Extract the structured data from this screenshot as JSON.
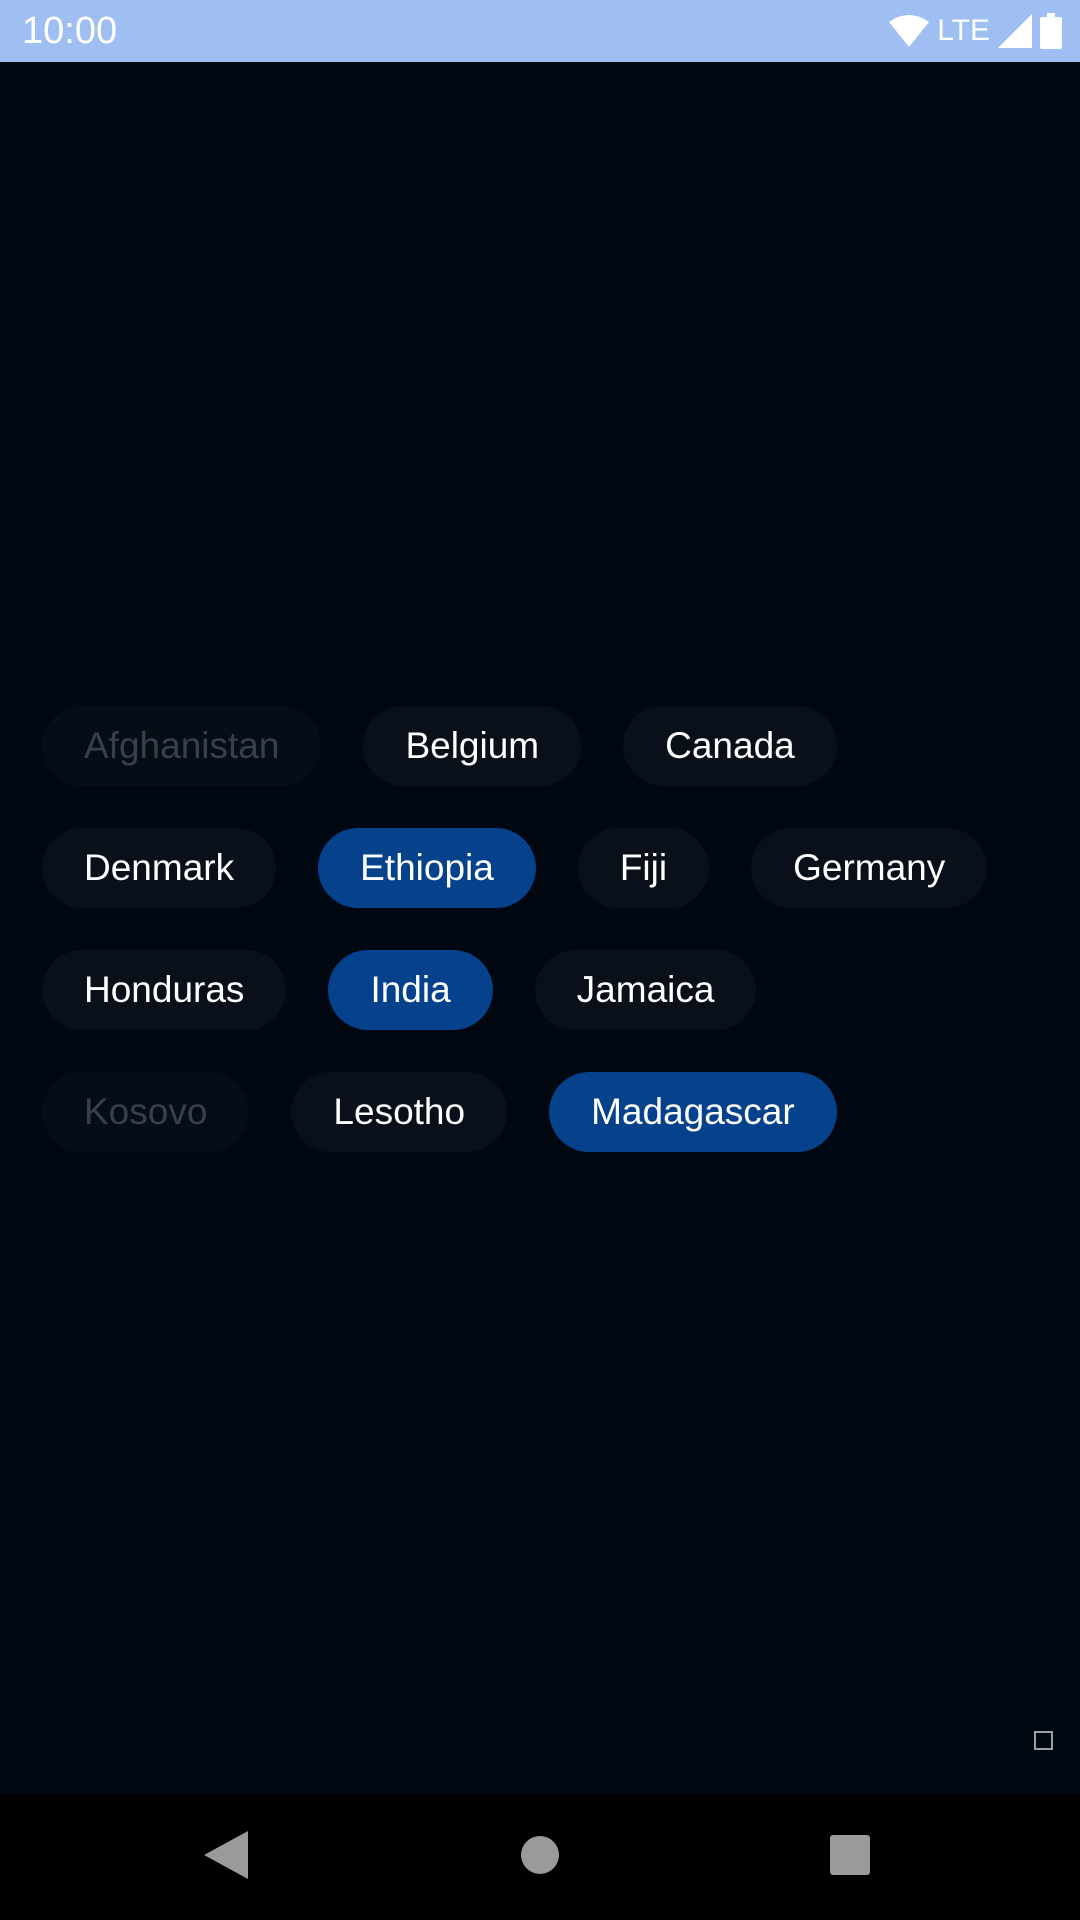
{
  "status_bar": {
    "time": "10:00",
    "network_label": "LTE",
    "icons": [
      "wifi-icon",
      "signal-icon",
      "battery-icon"
    ],
    "background": "#9FBFF2"
  },
  "chips": {
    "rows": [
      [
        {
          "label": "Afghanistan",
          "state": "disabled"
        },
        {
          "label": "Belgium",
          "state": "normal"
        },
        {
          "label": "Canada",
          "state": "normal"
        }
      ],
      [
        {
          "label": "Denmark",
          "state": "normal"
        },
        {
          "label": "Ethiopia",
          "state": "selected"
        },
        {
          "label": "Fiji",
          "state": "normal"
        },
        {
          "label": "Germany",
          "state": "normal"
        }
      ],
      [
        {
          "label": "Honduras",
          "state": "normal"
        },
        {
          "label": "India",
          "state": "selected"
        },
        {
          "label": "Jamaica",
          "state": "normal"
        }
      ],
      [
        {
          "label": "Kosovo",
          "state": "disabled"
        },
        {
          "label": "Lesotho",
          "state": "normal"
        },
        {
          "label": "Madagascar",
          "state": "selected"
        }
      ]
    ],
    "colors": {
      "normal_bg": "#0A101A",
      "selected_bg": "#06418C",
      "disabled_bg": "#070D16",
      "disabled_text": "#3A404A"
    }
  },
  "navigation": {
    "buttons": [
      "back-icon",
      "home-icon",
      "recents-icon"
    ]
  },
  "colors": {
    "background": "#020812"
  }
}
